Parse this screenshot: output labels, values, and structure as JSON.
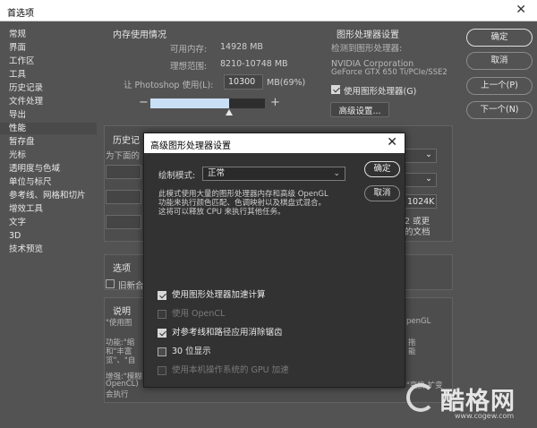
{
  "window": {
    "title": "首选项"
  },
  "sidebar": {
    "items": [
      {
        "label": "常规"
      },
      {
        "label": "界面"
      },
      {
        "label": "工作区"
      },
      {
        "label": "工具"
      },
      {
        "label": "历史记录"
      },
      {
        "label": "文件处理"
      },
      {
        "label": "导出"
      },
      {
        "label": "性能",
        "active": true
      },
      {
        "label": "暂存盘"
      },
      {
        "label": "光标"
      },
      {
        "label": "透明度与色域"
      },
      {
        "label": "单位与标尺"
      },
      {
        "label": "参考线、网格和切片"
      },
      {
        "label": "增效工具"
      },
      {
        "label": "文字"
      },
      {
        "label": "3D"
      },
      {
        "label": "技术预览"
      }
    ]
  },
  "memory": {
    "title": "内存使用情况",
    "available_label": "可用内存:",
    "available_value": "14928 MB",
    "ideal_label": "理想范围:",
    "ideal_value": "8210-10748 MB",
    "let_label": "让 Photoshop 使用(L):",
    "use_value": "10300",
    "unit_pct": "MB(69%)",
    "minus": "−",
    "plus": "+",
    "slider_fraction": 0.69
  },
  "gpu": {
    "title": "图形处理器设置",
    "detected_label": "检测到图形处理器:",
    "vendor": "NVIDIA Corporation",
    "model": "GeForce GTX 650 Ti/PCIe/SSE2",
    "use_gpu_label": "使用图形处理器(G)",
    "advanced_button": "高级设置..."
  },
  "buttons": {
    "ok": "确定",
    "cancel": "取消",
    "prev": "上一个(P)",
    "next": "下一个(N)"
  },
  "behind": {
    "history_title": "历史记",
    "history_text": "为下面的",
    "size_value": "1024K",
    "right_text1": "2 或更",
    "right_text2": "的文档",
    "options_title": "选项",
    "old_label": "旧新合",
    "desc_title": "说明",
    "desc_l1": "\"使用图",
    "desc_l2": "功能:\"缩",
    "desc_l3": "和\"丰富",
    "desc_l4": "览\"、\"自",
    "desc_l5": "增强:\"模糊",
    "desc_l6": "OpenCL)",
    "desc_l7": "会执行",
    "right_desc1": "penGL",
    "right_desc2": "拖",
    "right_desc3": "能",
    "right_desc4": "\"变换 扩变"
  },
  "dialog": {
    "title": "高级图形处理器设置",
    "mode_label": "绘制模式:",
    "mode_value": "正常",
    "ok": "确定",
    "cancel": "取消",
    "desc_line1": "此模式使用大量的图形处理器内存和高级 OpenGL",
    "desc_line2": "功能来执行颜色匹配、色调映射以及棋盘式混合。",
    "desc_line3": "这将可以释放 CPU 来执行其他任务。",
    "options": [
      {
        "label": "使用图形处理器加速计算",
        "checked": true,
        "enabled": true
      },
      {
        "label": "使用 OpenCL",
        "checked": false,
        "enabled": false
      },
      {
        "label": "对参考线和路径应用消除锯齿",
        "checked": true,
        "enabled": true
      },
      {
        "label": "30 位显示",
        "checked": false,
        "enabled": true
      },
      {
        "label": "使用本机操作系统的 GPU 加速",
        "checked": false,
        "enabled": false
      }
    ]
  },
  "watermark": {
    "brand": "酷格网",
    "url": "www.cogew.com"
  }
}
